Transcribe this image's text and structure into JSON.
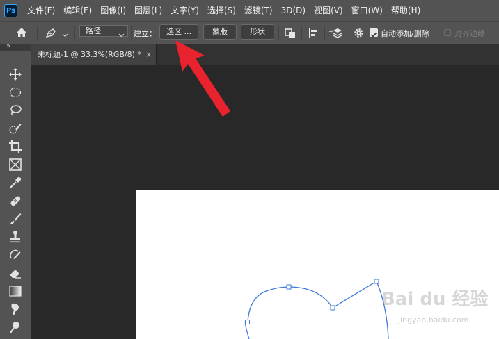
{
  "app": {
    "logo_text": "Ps"
  },
  "menu": {
    "items": [
      {
        "label": "文件(F)"
      },
      {
        "label": "编辑(E)"
      },
      {
        "label": "图像(I)"
      },
      {
        "label": "图层(L)"
      },
      {
        "label": "文字(Y)"
      },
      {
        "label": "选择(S)"
      },
      {
        "label": "滤镜(T)"
      },
      {
        "label": "3D(D)"
      },
      {
        "label": "视图(V)"
      },
      {
        "label": "窗口(W)"
      },
      {
        "label": "帮助(H)"
      }
    ]
  },
  "options_bar": {
    "mode_select_value": "路径",
    "make_label": "建立：",
    "selection_button": "选区 ...",
    "mask_button": "蒙版",
    "shape_button": "形状",
    "auto_add_delete_label": "自动添加/删除",
    "auto_add_delete_checked": true,
    "align_edges_label": "对齐边缘",
    "align_edges_checked": false
  },
  "document_tab": {
    "title": "未标题-1 @ 33.3%(RGB/8) *",
    "close_glyph": "×"
  },
  "toolbar": {
    "collapse_glyph": "»",
    "tools": [
      "move-tool",
      "ellipse-marquee-tool",
      "lasso-tool",
      "quick-selection-tool",
      "crop-tool",
      "frame-tool",
      "eyedropper-tool",
      "healing-brush-tool",
      "brush-tool",
      "clone-stamp-tool",
      "history-brush-tool",
      "eraser-tool",
      "gradient-tool",
      "smudge-tool",
      "dodge-tool"
    ]
  },
  "canvas": {
    "path_color": "#3c78d8",
    "background": "#ffffff"
  },
  "watermark": {
    "brand": "Bai du 经验",
    "url": "jingyan.baidu.com"
  },
  "annotation": {
    "arrow_color": "#e8232e"
  }
}
